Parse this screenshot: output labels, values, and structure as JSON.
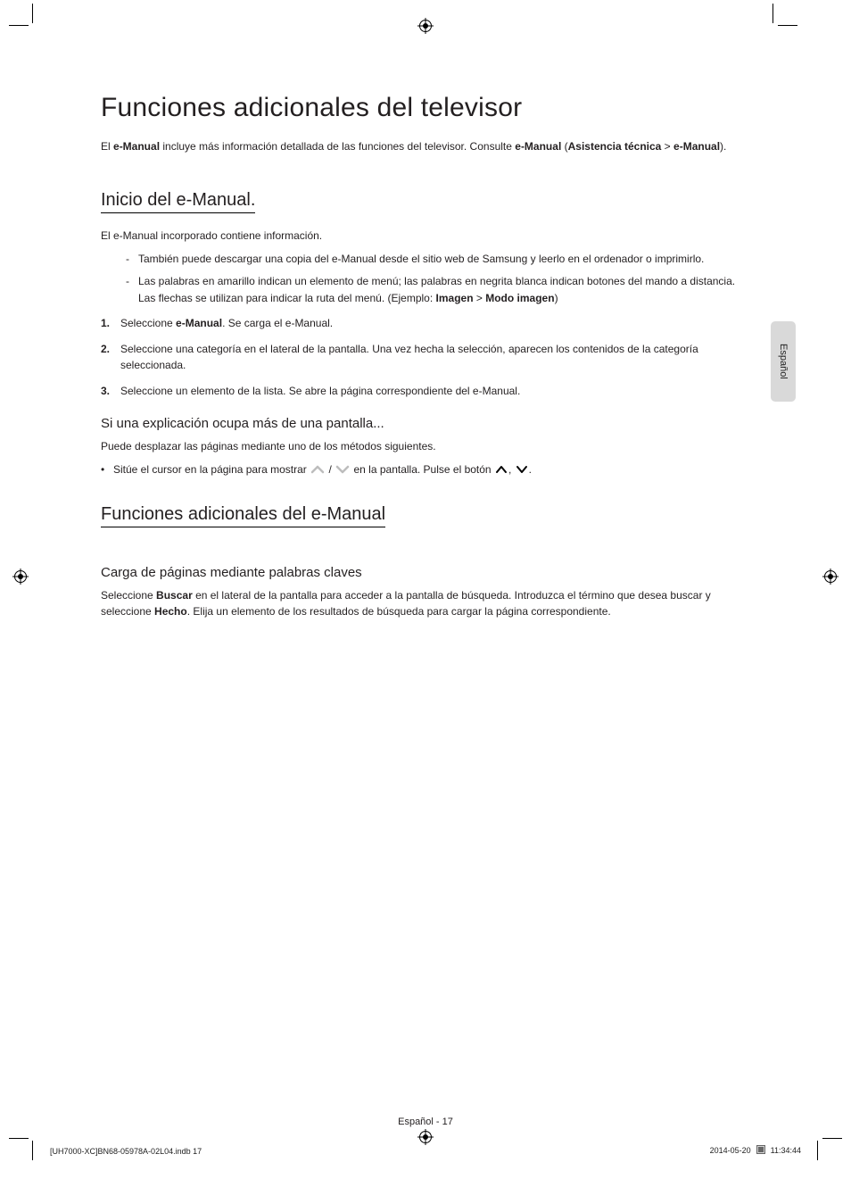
{
  "language_tab": "Español",
  "title": "Funciones adicionales del televisor",
  "intro": {
    "prefix": "El ",
    "bold1": "e-Manual",
    "mid": " incluye más información detallada de las funciones del televisor. Consulte ",
    "bold2": "e-Manual",
    "paren_open": " (",
    "bold3": "Asistencia técnica",
    "gt": " > ",
    "bold4": "e-Manual",
    "paren_close": ")."
  },
  "section1": {
    "heading": "Inicio del e-Manual.",
    "lead": "El e-Manual incorporado contiene información.",
    "dash1": "También puede descargar una copia del e-Manual desde el sitio web de Samsung y leerlo en el ordenador o imprimirlo.",
    "dash2": {
      "a": "Las palabras en amarillo indican un elemento de menú; las palabras en negrita blanca indican botones del mando a distancia. Las flechas se utilizan para indicar la ruta del menú. (Ejemplo: ",
      "b1": "Imagen",
      "sep": " > ",
      "b2": "Modo imagen",
      "end": ")"
    },
    "step1": {
      "n": "1.",
      "a": "Seleccione ",
      "b": "e-Manual",
      "c": ". Se carga el e-Manual."
    },
    "step2": {
      "n": "2.",
      "text": "Seleccione una categoría en el lateral de la pantalla. Una vez hecha la selección, aparecen los contenidos de la categoría seleccionada."
    },
    "step3": {
      "n": "3.",
      "text": "Seleccione un elemento de la lista. Se abre la página correspondiente del e-Manual."
    },
    "sub_heading": "Si una explicación ocupa más de una pantalla...",
    "sub_lead": "Puede desplazar las páginas mediante uno de los métodos siguientes.",
    "cursor": {
      "a": "Sitúe el cursor en la página para mostrar ",
      "b": " / ",
      "c": " en la pantalla. Pulse el botón ",
      "d": ", ",
      "e": "."
    }
  },
  "section2": {
    "heading": "Funciones adicionales del e-Manual",
    "sub_heading": "Carga de páginas mediante palabras claves",
    "p": {
      "a": "Seleccione ",
      "b1": "Buscar",
      "b": " en el lateral de la pantalla para acceder a la pantalla de búsqueda. Introduzca el término que desea buscar y seleccione ",
      "b2": "Hecho",
      "c": ". Elija un elemento de los resultados de búsqueda para cargar la página correspondiente."
    }
  },
  "footer": {
    "page": "Español - 17",
    "left": "[UH7000-XC]BN68-05978A-02L04.indb   17",
    "right_date": "2014-05-20   ",
    "right_time": "11:34:44"
  }
}
